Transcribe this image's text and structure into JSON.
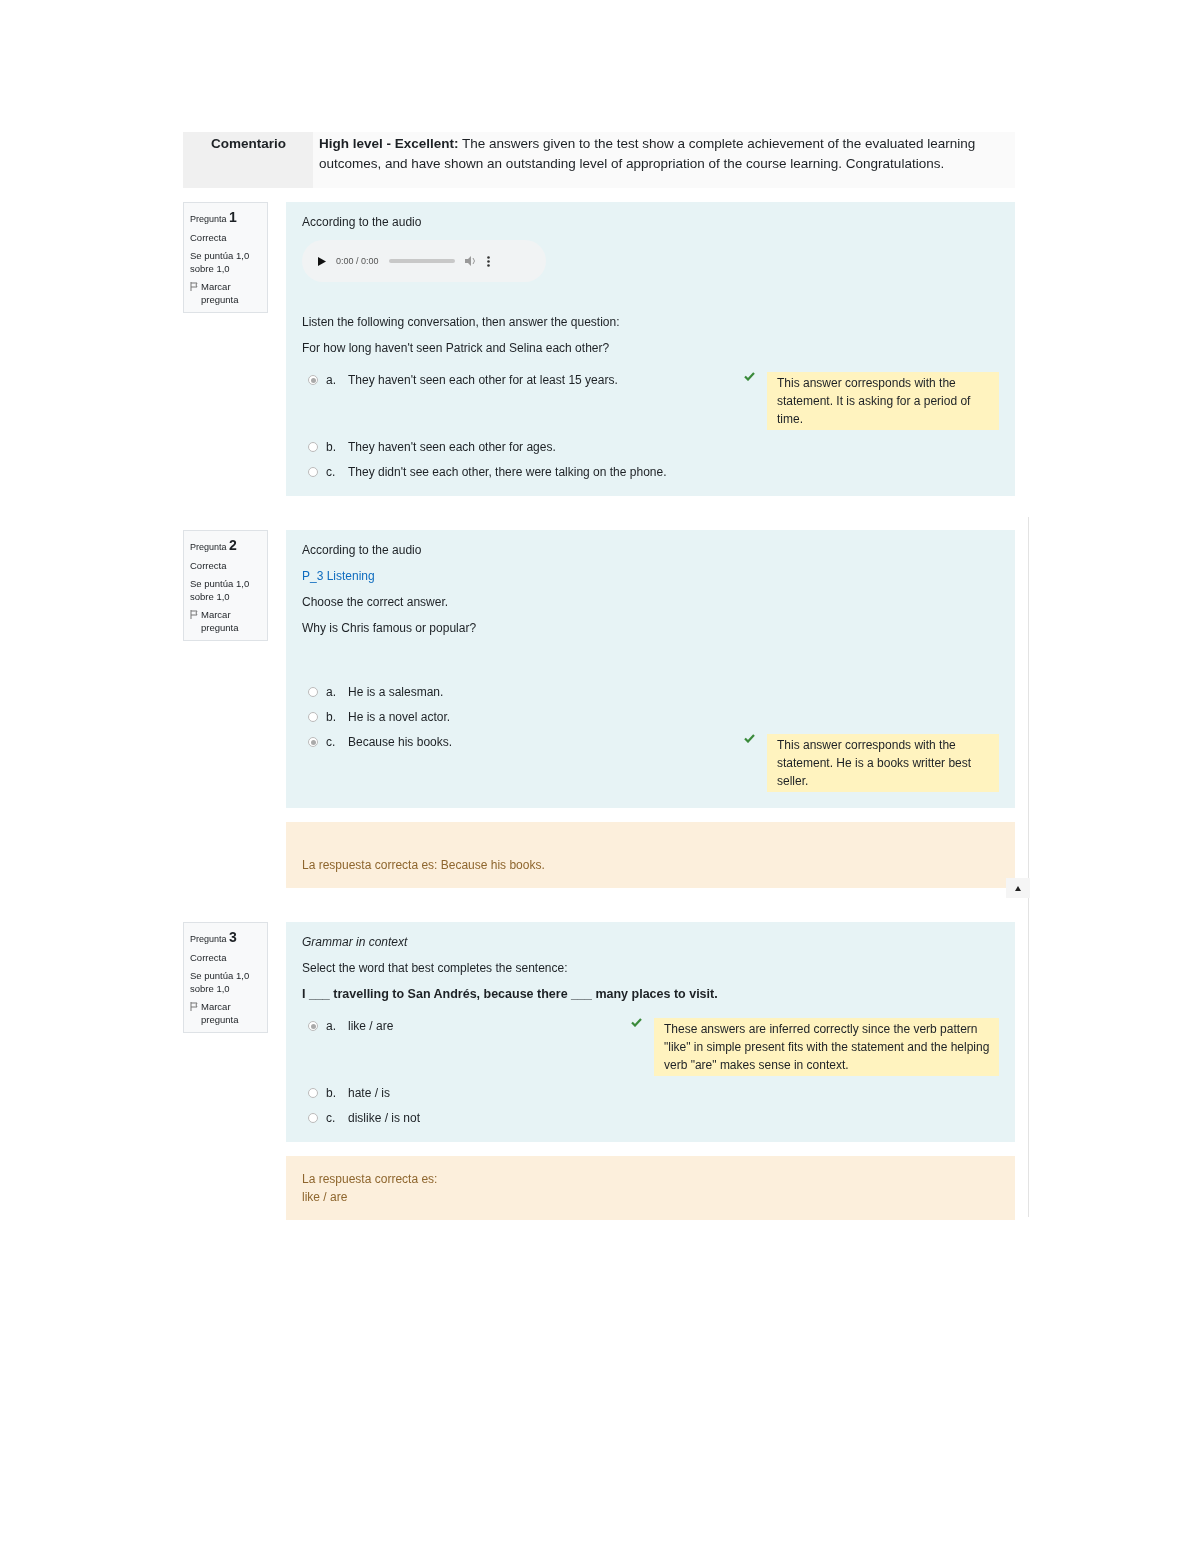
{
  "comment": {
    "label": "Comentario",
    "heading": "High level - Excellent:",
    "text": "The answers given to the test show a complete achievement of the evaluated learning outcomes, and have shown an outstanding level of appropriation of the course learning. Congratulations."
  },
  "questions": [
    {
      "label": "Pregunta",
      "number": "1",
      "status": "Correcta",
      "score": "Se puntúa 1,0 sobre 1,0",
      "flag": "Marcar pregunta",
      "content": [
        {
          "kind": "text",
          "text": "According to the audio"
        },
        {
          "kind": "audio",
          "time": "0:00 / 0:00"
        },
        {
          "kind": "text",
          "text": "Listen the following conversation, then answer the question:"
        },
        {
          "kind": "text",
          "text": "For how long haven't seen Patrick and Selina each other?"
        }
      ],
      "options": [
        {
          "letter": "a.",
          "text": "They haven't seen each other for at least 15 years.",
          "selected": true,
          "feedback": "This answer corresponds with the statement. It is asking for a period of time."
        },
        {
          "letter": "b.",
          "text": "They haven't seen each other for ages.",
          "selected": false
        },
        {
          "letter": "c.",
          "text": "They didn't see each other, there were talking on the phone.",
          "selected": false
        }
      ]
    },
    {
      "label": "Pregunta",
      "number": "2",
      "status": "Correcta",
      "score": "Se puntúa 1,0 sobre 1,0",
      "flag": "Marcar pregunta",
      "content": [
        {
          "kind": "text",
          "text": "According to the audio"
        },
        {
          "kind": "link",
          "text": "P_3 Listening"
        },
        {
          "kind": "text",
          "text": "Choose the correct answer."
        },
        {
          "kind": "text",
          "text": "Why is Chris famous or popular?"
        }
      ],
      "options": [
        {
          "letter": "a.",
          "text": "He is a salesman.",
          "selected": false
        },
        {
          "letter": "b.",
          "text": "He is a novel actor.",
          "selected": false
        },
        {
          "letter": "c.",
          "text": "Because his books.",
          "selected": true,
          "feedback": "This answer corresponds with the statement. He is a books writter best seller."
        }
      ],
      "right_answer": [
        "La respuesta correcta es: Because his books."
      ]
    },
    {
      "label": "Pregunta",
      "number": "3",
      "status": "Correcta",
      "score": "Se puntúa 1,0 sobre 1,0",
      "flag": "Marcar pregunta",
      "content": [
        {
          "kind": "italic",
          "text": "Grammar in context"
        },
        {
          "kind": "text",
          "text": "Select the word that best completes the sentence:"
        },
        {
          "kind": "bold",
          "text": "I ___ travelling to San Andrés, because there ___ many places to visit."
        }
      ],
      "options": [
        {
          "letter": "a.",
          "text": "like / are",
          "selected": true,
          "feedback": "These answers are inferred correctly since the verb pattern \"like\" in simple present fits with the statement and the helping verb \"are\" makes sense in context."
        },
        {
          "letter": "b.",
          "text": "hate / is",
          "selected": false
        },
        {
          "letter": "c.",
          "text": "dislike / is not",
          "selected": false
        }
      ],
      "right_answer": [
        "La respuesta correcta es:",
        "like / are"
      ]
    }
  ]
}
